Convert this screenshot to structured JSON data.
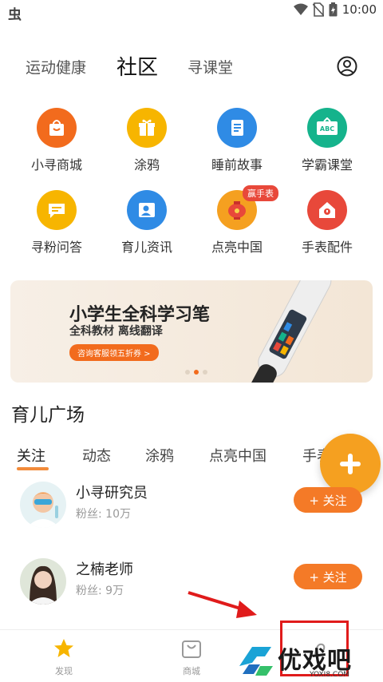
{
  "status_bar": {
    "time": "10:00"
  },
  "top_tabs": [
    {
      "label": "运动健康"
    },
    {
      "label": "社区"
    },
    {
      "label": "寻课堂"
    }
  ],
  "grid": [
    {
      "label": "小寻商城",
      "icon": "shop-bag-icon",
      "color": "#f26b1d"
    },
    {
      "label": "涂鸦",
      "icon": "gift-icon",
      "color": "#f7b500"
    },
    {
      "label": "睡前故事",
      "icon": "book-icon",
      "color": "#2f8be5"
    },
    {
      "label": "学霸课堂",
      "icon": "abc-board-icon",
      "color": "#15b38c"
    },
    {
      "label": "寻粉问答",
      "icon": "chat-icon",
      "color": "#f7b500"
    },
    {
      "label": "育儿资讯",
      "icon": "person-card-icon",
      "color": "#2f8be5"
    },
    {
      "label": "点亮中国",
      "icon": "lantern-icon",
      "color": "#f5a020",
      "badge": "赢手表"
    },
    {
      "label": "手表配件",
      "icon": "house-icon",
      "color": "#e8483a"
    }
  ],
  "banner": {
    "title": "小学生全科学习笔",
    "subtitle": "全科教材 离线翻译",
    "button": "咨询客服领五折券 >"
  },
  "section_title": "育儿广场",
  "sub_tabs": [
    {
      "label": "关注"
    },
    {
      "label": "动态"
    },
    {
      "label": "涂鸦"
    },
    {
      "label": "点亮中国"
    },
    {
      "label": "手表"
    }
  ],
  "users": [
    {
      "name": "小寻研究员",
      "fans": "粉丝: 10万",
      "follow": "+ 关注"
    },
    {
      "name": "之楠老师",
      "fans": "粉丝: 9万",
      "follow": "+ 关注"
    }
  ],
  "bottom_nav": [
    {
      "label": "发现"
    },
    {
      "label": "商城"
    }
  ],
  "watermark": {
    "text": "优戏吧",
    "sub": "YOXI8.COM"
  }
}
